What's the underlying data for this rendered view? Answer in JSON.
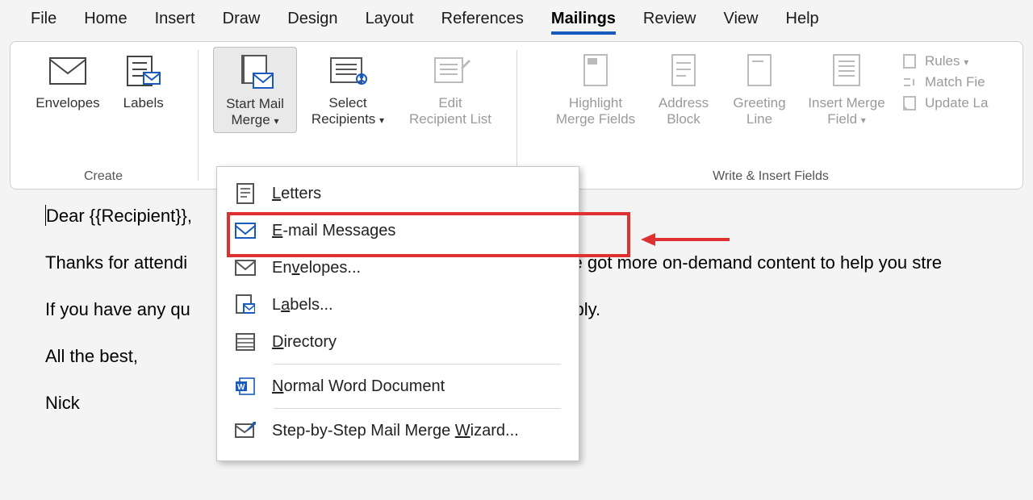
{
  "tabs": [
    "File",
    "Home",
    "Insert",
    "Draw",
    "Design",
    "Layout",
    "References",
    "Mailings",
    "Review",
    "View",
    "Help"
  ],
  "active_tab": "Mailings",
  "ribbon": {
    "create": {
      "envelopes": "Envelopes",
      "labels": "Labels",
      "group_label": "Create"
    },
    "start": {
      "start_mail_merge": "Start Mail Merge",
      "select_recipients": "Select Recipients",
      "edit_recipient_list": "Edit Recipient List"
    },
    "write": {
      "highlight": "Highlight Merge Fields",
      "address_block": "Address Block",
      "greeting_line": "Greeting Line",
      "insert_merge_field": "Insert Merge Field",
      "rules": "Rules",
      "match_fields": "Match Fie",
      "update_labels": "Update La",
      "group_label": "Write & Insert Fields"
    }
  },
  "menu": {
    "letters": "Letters",
    "email": "E-mail Messages",
    "envelopes": "Envelopes...",
    "labels": "Labels...",
    "directory": "Directory",
    "normal": "Normal Word Document",
    "wizard": "Step-by-Step Mail Merge Wizard..."
  },
  "document": {
    "l1_pre": "Dear {{Recipient}},",
    "l2_pre": "Thanks for attendi",
    "l2_post": "e've got more on-demand content to help you stre",
    "l3_pre": "If you have any qu",
    "l3_post": " reply.",
    "l4": "All the best,",
    "l5": "Nick"
  }
}
